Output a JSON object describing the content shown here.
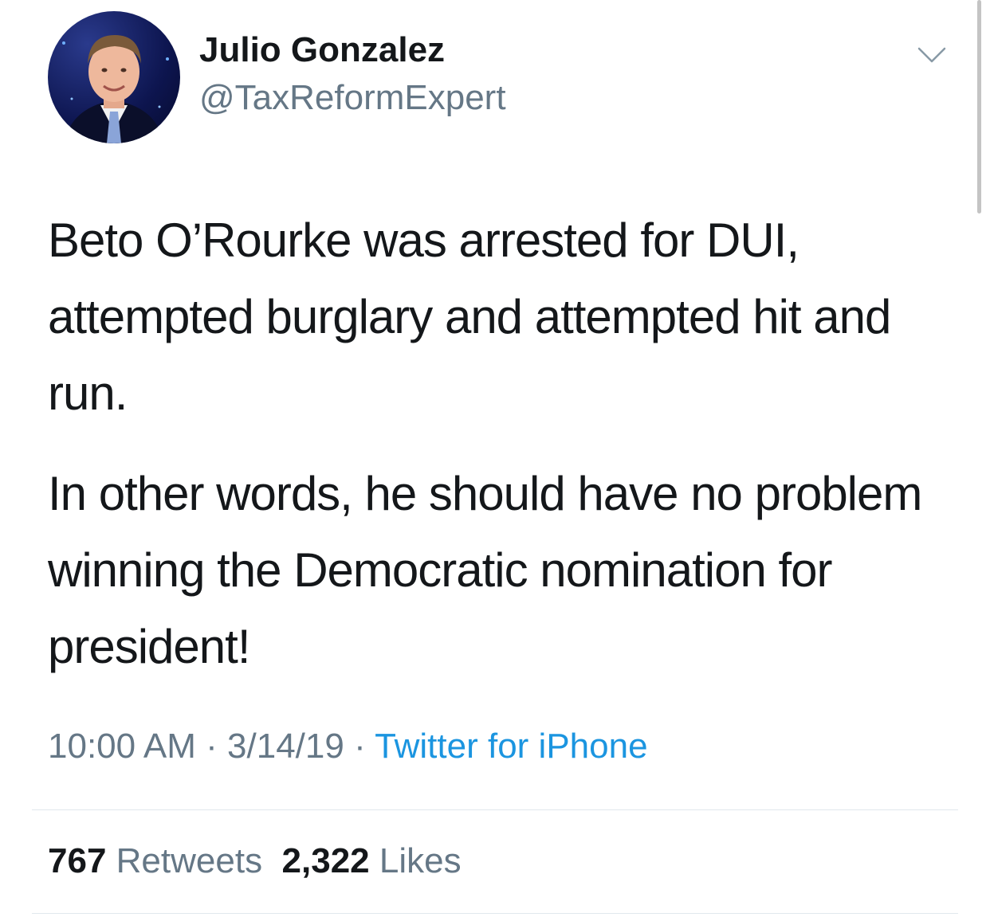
{
  "author": {
    "name": "Julio Gonzalez",
    "handle": "@TaxReformExpert"
  },
  "tweet": {
    "paragraphs": [
      "Beto O’Rourke was arrested for DUI, attempted burglary and attempted hit and run.",
      "In other words, he should have no problem winning the Democratic nomination for president!"
    ]
  },
  "meta": {
    "time": "10:00 AM",
    "separator": "·",
    "date": "3/14/19",
    "source": "Twitter for iPhone"
  },
  "stats": {
    "retweets_count": "767",
    "retweets_label": "Retweets",
    "likes_count": "2,322",
    "likes_label": "Likes"
  },
  "icons": {
    "menu": "chevron-down-icon"
  },
  "colors": {
    "text": "#14171a",
    "secondary": "#657786",
    "link": "#1b95e0",
    "divider": "#e1e8ed"
  }
}
